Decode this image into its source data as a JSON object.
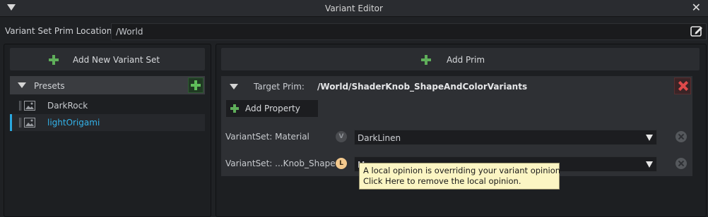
{
  "window": {
    "title": "Variant Editor",
    "close_glyph": "✕"
  },
  "location": {
    "label": "Variant Set Prim Location",
    "value": "/World"
  },
  "left": {
    "add_variant_set_label": "Add New Variant Set",
    "variant_set": {
      "name": "Presets",
      "variants": [
        {
          "name": "DarkRock",
          "selected": false
        },
        {
          "name": "lightOrigami",
          "selected": true
        }
      ]
    }
  },
  "right": {
    "add_prim_label": "Add Prim",
    "target": {
      "label": "Target Prim:",
      "path": "/World/ShaderKnob_ShapeAndColorVariants",
      "add_property_label": "Add Property",
      "rows": [
        {
          "label": "VariantSet: Material",
          "badge": "V",
          "value": "DarkLinen"
        },
        {
          "label": "VariantSet: ...Knob_Shape",
          "badge": "L",
          "value": "M"
        }
      ]
    }
  },
  "tooltip": {
    "line1": "A local opinion is overriding your variant opinion",
    "line2": "Click Here to remove the local opinion."
  },
  "colors": {
    "accent": "#33b3ea",
    "add_green": "#5fae5a",
    "delete_red": "#e04a4a",
    "local_badge": "#f3c98e",
    "tooltip_bg": "#fbf5c3"
  }
}
